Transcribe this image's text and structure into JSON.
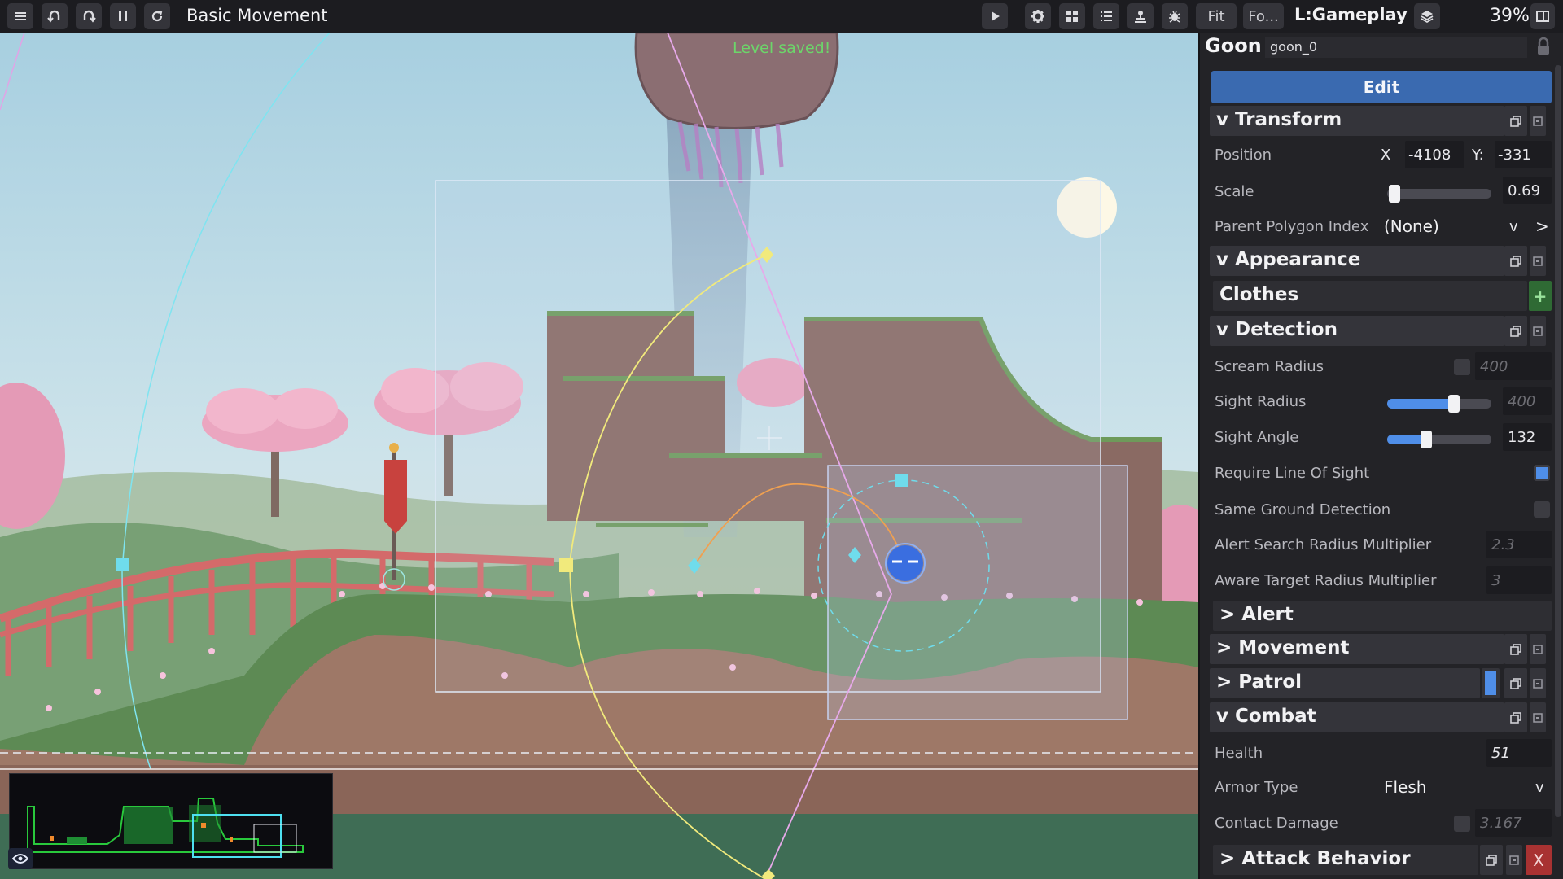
{
  "toolbar": {
    "title": "Basic Movement",
    "fit_label": "Fit",
    "focus_label": "Fo...",
    "layer": "L:Gameplay",
    "zoom": "39%"
  },
  "viewport": {
    "saved_message": "Level saved!"
  },
  "inspector": {
    "object_type": "Goon",
    "object_id": "goon_0",
    "edit_label": "Edit",
    "transform": {
      "header": "v Transform",
      "position_label": "Position",
      "x_label": "X",
      "x_value": "-4108",
      "y_label": "Y:",
      "y_value": "-331",
      "scale_label": "Scale",
      "scale_value": "0.69",
      "parent_label": "Parent Polygon Index",
      "parent_value": "(None)",
      "dropdown_arrow": "v",
      "goto_arrow": ">"
    },
    "appearance": {
      "header": "v Appearance",
      "clothes_header": "Clothes",
      "add_glyph": "+"
    },
    "detection": {
      "header": "v Detection",
      "scream_radius_label": "Scream Radius",
      "scream_radius_value": "400",
      "sight_radius_label": "Sight Radius",
      "sight_radius_value": "400",
      "sight_radius_fraction": 0.66,
      "sight_angle_label": "Sight Angle",
      "sight_angle_value": "132",
      "sight_angle_fraction": 0.36,
      "line_of_sight_label": "Require Line Of Sight",
      "line_of_sight_checked": true,
      "same_ground_label": "Same Ground Detection",
      "same_ground_checked": false,
      "alert_search_label": "Alert Search Radius Multiplier",
      "alert_search_value": "2.3",
      "aware_target_label": "Aware Target Radius Multiplier",
      "aware_target_value": "3"
    },
    "alert": {
      "header": "> Alert"
    },
    "movement": {
      "header": "> Movement"
    },
    "patrol": {
      "header": "> Patrol"
    },
    "combat": {
      "header": "v Combat",
      "health_label": "Health",
      "health_value": "51",
      "armor_label": "Armor Type",
      "armor_value": "Flesh",
      "dropdown_arrow": "v",
      "contact_damage_label": "Contact Damage",
      "contact_damage_value": "3.167"
    },
    "attack_behavior": {
      "header": "> Attack Behavior",
      "delete_glyph": "X"
    },
    "scale_fraction": 0.02
  },
  "colors": {
    "accent": "#4f8ee8",
    "edit_button": "#3a6ab0",
    "saved_message": "#6cd66a",
    "delete_button": "#a83232"
  },
  "icons": [
    "menu-icon",
    "undo-icon",
    "redo-icon",
    "pause-icon",
    "reload-icon",
    "play-icon",
    "gear-icon",
    "grid-icon",
    "list-icon",
    "stamp-icon",
    "bug-icon",
    "layers-icon",
    "panel-toggle-icon",
    "lock-icon",
    "copy-icon",
    "collapse-icon",
    "eye-icon"
  ]
}
